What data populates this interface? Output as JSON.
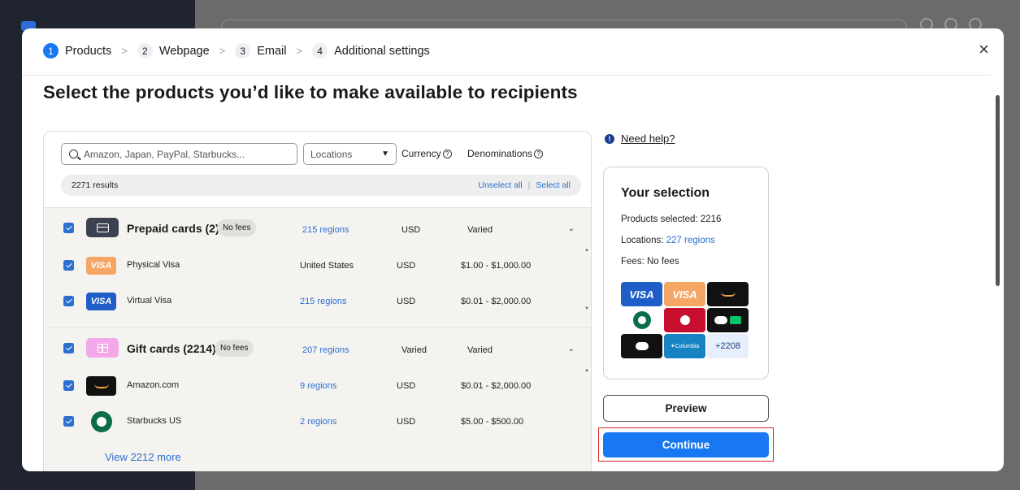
{
  "stepper": {
    "steps": [
      {
        "num": "1",
        "label": "Products"
      },
      {
        "num": "2",
        "label": "Webpage"
      },
      {
        "num": "3",
        "label": "Email"
      },
      {
        "num": "4",
        "label": "Additional settings"
      }
    ],
    "active_step": 1
  },
  "close_icon": "×",
  "title": "Select the products you’d like to make available to recipients",
  "filters": {
    "search_placeholder": "Amazon, Japan, PayPal, Starbucks...",
    "locations_label": "Locations",
    "currency_label": "Currency",
    "denominations_label": "Denominations",
    "help_glyph": "?"
  },
  "results": {
    "count": "2271 results",
    "unselect_all": "Unselect all",
    "select_all": "Select all"
  },
  "groups": [
    {
      "title": "Prepaid cards (2)",
      "badge": "No fees",
      "regions": "215 regions",
      "currency": "USD",
      "denomination": "Varied",
      "icon": "credit-card-icon",
      "rows": [
        {
          "name": "Physical Visa",
          "logo": "VISA",
          "regions": "United States",
          "currency": "USD",
          "denomination": "$1.00 - $1,000.00"
        },
        {
          "name": "Virtual Visa",
          "logo": "VISA",
          "regions": "215 regions",
          "currency": "USD",
          "denomination": "$0.01 - $2,000.00"
        }
      ]
    },
    {
      "title": "Gift cards (2214)",
      "badge": "No fees",
      "regions": "207 regions",
      "currency": "Varied",
      "denomination": "Varied",
      "icon": "gift-icon",
      "rows": [
        {
          "name": "Amazon.com",
          "logo": "amazon",
          "regions": "9 regions",
          "currency": "USD",
          "denomination": "$0.01 - $2,000.00"
        },
        {
          "name": "Starbucks US",
          "logo": "starbucks",
          "regions": "2 regions",
          "currency": "USD",
          "denomination": "$5.00 - $500.00"
        }
      ],
      "view_more": "View 2212 more"
    }
  ],
  "help": {
    "info_glyph": "!",
    "label": "Need help?"
  },
  "selection": {
    "title": "Your selection",
    "products_selected": "Products selected: 2216",
    "locations_prefix": "Locations:",
    "locations_value": "227 regions",
    "fees": "Fees: No fees",
    "logo_visa": "VISA",
    "logo_columbia": "✦Columbia",
    "more_count": "+2208"
  },
  "actions": {
    "preview": "Preview",
    "continue": "Continue"
  },
  "colors": {
    "accent": "#1877f2",
    "link": "#2c6fd1",
    "highlight_border": "#dd2222"
  }
}
